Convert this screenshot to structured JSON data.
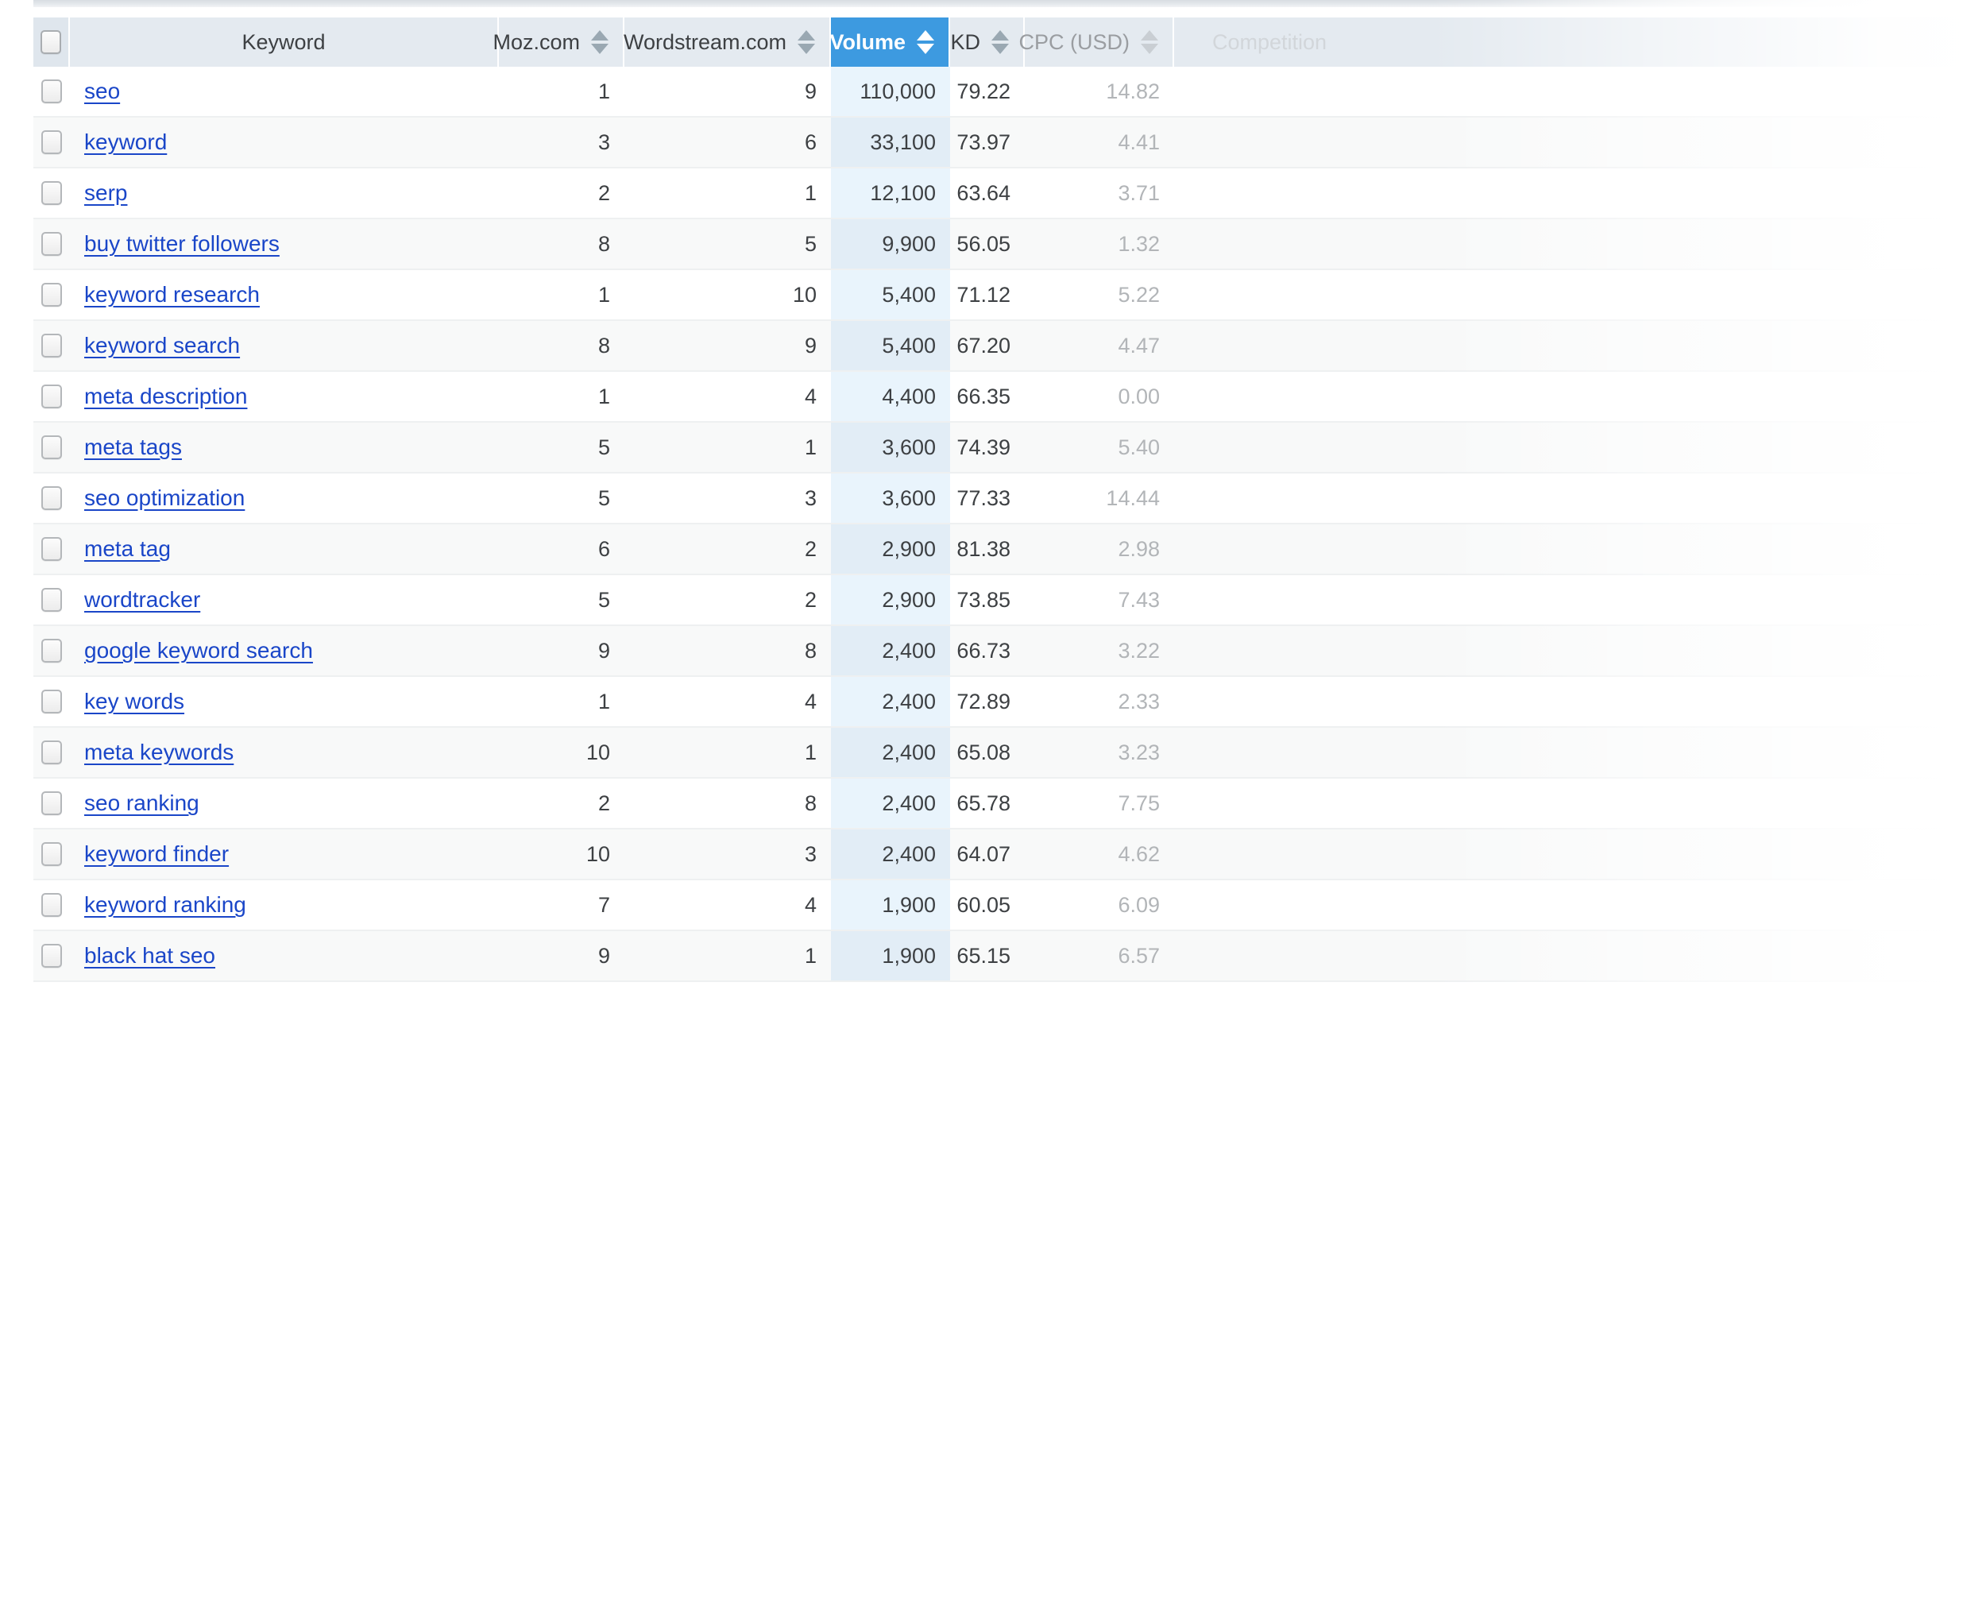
{
  "table": {
    "columns": [
      {
        "key": "checkbox",
        "label": "",
        "sortable": false,
        "align": "center"
      },
      {
        "key": "keyword",
        "label": "Keyword",
        "sortable": false,
        "align": "center"
      },
      {
        "key": "moz",
        "label": "Moz.com",
        "sortable": true,
        "align": "right"
      },
      {
        "key": "wordstream",
        "label": "Wordstream.com",
        "sortable": true,
        "align": "right"
      },
      {
        "key": "volume",
        "label": "Volume",
        "sortable": true,
        "align": "right",
        "sorted": true,
        "sort_direction": "desc"
      },
      {
        "key": "kd",
        "label": "KD",
        "sortable": true,
        "align": "right"
      },
      {
        "key": "cpc",
        "label": "CPC (USD)",
        "sortable": true,
        "align": "right"
      },
      {
        "key": "competition",
        "label": "Competition",
        "sortable": false,
        "align": "left",
        "truncated": true
      }
    ],
    "select_all_checked": false,
    "rows": [
      {
        "keyword": "seo",
        "moz": "1",
        "wordstream": "9",
        "volume": "110,000",
        "kd": "79.22",
        "cpc": "14.82",
        "competition": "",
        "checked": false
      },
      {
        "keyword": "keyword",
        "moz": "3",
        "wordstream": "6",
        "volume": "33,100",
        "kd": "73.97",
        "cpc": "4.41",
        "competition": "",
        "checked": false
      },
      {
        "keyword": "serp",
        "moz": "2",
        "wordstream": "1",
        "volume": "12,100",
        "kd": "63.64",
        "cpc": "3.71",
        "competition": "",
        "checked": false
      },
      {
        "keyword": "buy twitter followers",
        "moz": "8",
        "wordstream": "5",
        "volume": "9,900",
        "kd": "56.05",
        "cpc": "1.32",
        "competition": "",
        "checked": false
      },
      {
        "keyword": "keyword research",
        "moz": "1",
        "wordstream": "10",
        "volume": "5,400",
        "kd": "71.12",
        "cpc": "5.22",
        "competition": "",
        "checked": false
      },
      {
        "keyword": "keyword search",
        "moz": "8",
        "wordstream": "9",
        "volume": "5,400",
        "kd": "67.20",
        "cpc": "4.47",
        "competition": "",
        "checked": false
      },
      {
        "keyword": "meta description",
        "moz": "1",
        "wordstream": "4",
        "volume": "4,400",
        "kd": "66.35",
        "cpc": "0.00",
        "competition": "",
        "checked": false
      },
      {
        "keyword": "meta tags",
        "moz": "5",
        "wordstream": "1",
        "volume": "3,600",
        "kd": "74.39",
        "cpc": "5.40",
        "competition": "",
        "checked": false
      },
      {
        "keyword": "seo optimization",
        "moz": "5",
        "wordstream": "3",
        "volume": "3,600",
        "kd": "77.33",
        "cpc": "14.44",
        "competition": "",
        "checked": false
      },
      {
        "keyword": "meta tag",
        "moz": "6",
        "wordstream": "2",
        "volume": "2,900",
        "kd": "81.38",
        "cpc": "2.98",
        "competition": "",
        "checked": false
      },
      {
        "keyword": "wordtracker",
        "moz": "5",
        "wordstream": "2",
        "volume": "2,900",
        "kd": "73.85",
        "cpc": "7.43",
        "competition": "",
        "checked": false
      },
      {
        "keyword": "google keyword search",
        "moz": "9",
        "wordstream": "8",
        "volume": "2,400",
        "kd": "66.73",
        "cpc": "3.22",
        "competition": "",
        "checked": false
      },
      {
        "keyword": "key words",
        "moz": "1",
        "wordstream": "4",
        "volume": "2,400",
        "kd": "72.89",
        "cpc": "2.33",
        "competition": "",
        "checked": false
      },
      {
        "keyword": "meta keywords",
        "moz": "10",
        "wordstream": "1",
        "volume": "2,400",
        "kd": "65.08",
        "cpc": "3.23",
        "competition": "",
        "checked": false
      },
      {
        "keyword": "seo ranking",
        "moz": "2",
        "wordstream": "8",
        "volume": "2,400",
        "kd": "65.78",
        "cpc": "7.75",
        "competition": "",
        "checked": false
      },
      {
        "keyword": "keyword finder",
        "moz": "10",
        "wordstream": "3",
        "volume": "2,400",
        "kd": "64.07",
        "cpc": "4.62",
        "competition": "",
        "checked": false
      },
      {
        "keyword": "keyword ranking",
        "moz": "7",
        "wordstream": "4",
        "volume": "1,900",
        "kd": "60.05",
        "cpc": "6.09",
        "competition": "",
        "checked": false
      },
      {
        "keyword": "black hat seo",
        "moz": "9",
        "wordstream": "1",
        "volume": "1,900",
        "kd": "65.15",
        "cpc": "6.57",
        "competition": "",
        "checked": false
      }
    ]
  },
  "colors": {
    "sorted_header_bg": "#3d9ae0",
    "header_bg": "#e4eaf0",
    "link": "#1a46c8",
    "volume_cell_tint": "#e9f4fc",
    "row_alt_bg": "#f8f9f9",
    "muted_text": "#b2b5b8"
  },
  "icons": {
    "sort": "sort-arrows-icon",
    "checkbox": "checkbox-icon"
  }
}
